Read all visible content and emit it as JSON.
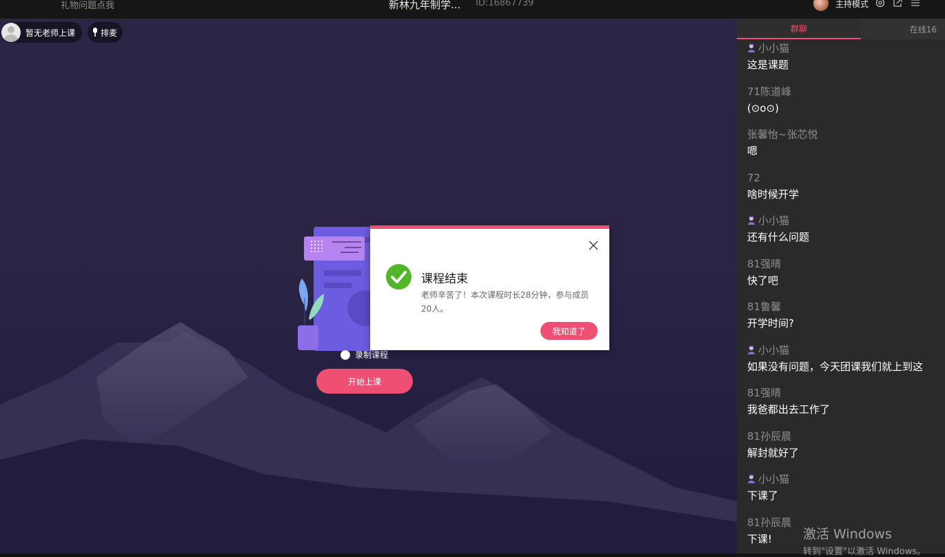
{
  "topbar": {
    "left_text": "礼物问题点我",
    "course_title": "新林九年制学...",
    "room_id": "ID:16867739",
    "mode_label": "主持模式"
  },
  "stage": {
    "teacher_status": "暂无老师上课",
    "mic_queue": "排麦",
    "record_label": "录制课程",
    "start_button": "开始上课"
  },
  "dialog": {
    "title": "课程结束",
    "message": "老师辛苦了！本次课程时长28分钟，参与成员20人。",
    "ok_button": "我知道了"
  },
  "sidebar": {
    "tab_chat": "群聊",
    "tab_online": "在线16",
    "messages": [
      {
        "name": "小小猫",
        "host": true,
        "text": "这是课题"
      },
      {
        "name": "71陈道峰",
        "host": false,
        "text": "(⊙o⊙)"
      },
      {
        "name": "张馨怡~张芯悦",
        "host": false,
        "text": "嗯"
      },
      {
        "name": "72",
        "host": false,
        "text": "啥时候开学"
      },
      {
        "name": "小小猫",
        "host": true,
        "text": "还有什么问题"
      },
      {
        "name": "81强晴",
        "host": false,
        "text": "快了吧"
      },
      {
        "name": "81鲁馨",
        "host": false,
        "text": "开学时间?"
      },
      {
        "name": "小小猫",
        "host": true,
        "text": "如果没有问题，今天团课我们就上到这"
      },
      {
        "name": "81强晴",
        "host": false,
        "text": "我爸都出去工作了"
      },
      {
        "name": "81孙辰晨",
        "host": false,
        "text": "解封就好了"
      },
      {
        "name": "小小猫",
        "host": true,
        "text": "下课了"
      },
      {
        "name": "81孙辰晨",
        "host": false,
        "text": "下课!"
      }
    ]
  },
  "watermark": {
    "line1": "激活 Windows",
    "line2": "转到\"设置\"以激活 Windows。"
  },
  "colors": {
    "accent": "#ee4f72",
    "success": "#52b52a",
    "sidebar_bg": "#2a2a2a"
  },
  "icons": [
    "settings-icon",
    "external-link-icon",
    "menu-icon",
    "microphone-icon",
    "close-icon",
    "check-icon",
    "host-badge-icon"
  ]
}
